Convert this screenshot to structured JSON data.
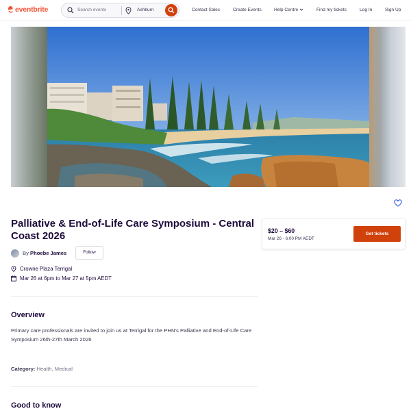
{
  "header": {
    "logo_text": "eventbrite",
    "search_placeholder": "Search events",
    "location": "Ashburn",
    "nav": {
      "contact_sales": "Contact Sales",
      "create_events": "Create Events",
      "help_centre": "Help Centre",
      "find_tickets": "Find my tickets",
      "log_in": "Log In",
      "sign_up": "Sign Up"
    }
  },
  "colors": {
    "brand": "#f05537",
    "accent": "#d1410c",
    "text": "#1e0a3c",
    "heart": "#3659e3"
  },
  "event": {
    "title": "Palliative & End-of-Life Care Symposium - Central Coast 2026",
    "by_label": "By",
    "organizer": "Phoebe James",
    "follow_label": "Follow",
    "venue": "Crowne Plaza Terrigal",
    "date_range": "Mar 26 at 6pm to Mar 27 at 5pm AEDT",
    "like_icon": "heart-icon"
  },
  "overview": {
    "heading": "Overview",
    "text": "Primary care professionals are invited to join us at Terrigal for the PHN's Palliative and End-of-Life Care Symposium 26th-27th March 2026",
    "category_label": "Category:",
    "category_value": "Health, Medical"
  },
  "good_to_know": {
    "heading": "Good to know"
  },
  "ticket": {
    "price": "$20 – $60",
    "date": "Mar 26 · 6:00 PM AEDT",
    "button": "Get tickets"
  }
}
